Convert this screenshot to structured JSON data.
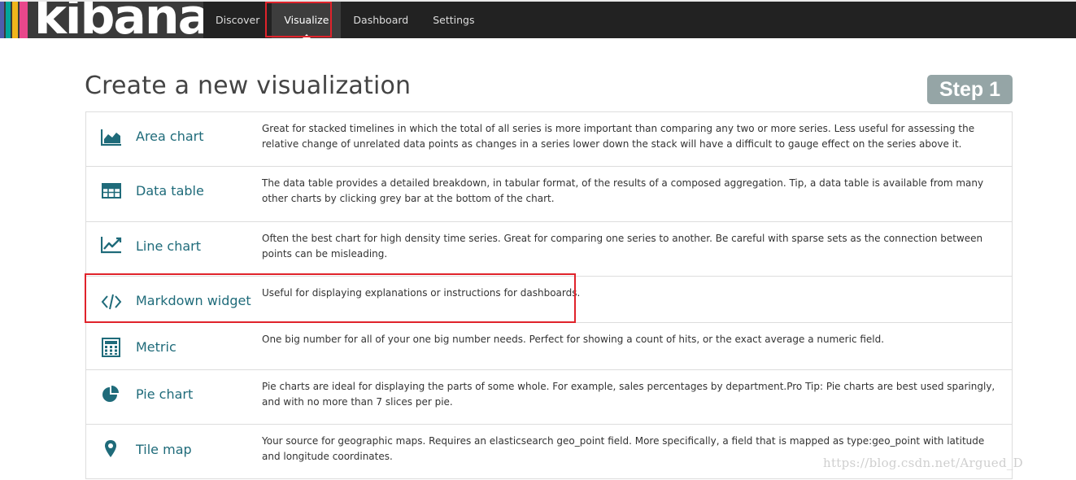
{
  "brand": {
    "logo_text": "kibana",
    "stripe_colors": [
      "#e8478b",
      "#f0b51b",
      "#00a69b",
      "#4e5dad"
    ]
  },
  "nav": {
    "items": [
      {
        "label": "Discover",
        "active": false
      },
      {
        "label": "Visualize",
        "active": true
      },
      {
        "label": "Dashboard",
        "active": false
      },
      {
        "label": "Settings",
        "active": false
      }
    ]
  },
  "page": {
    "title": "Create a new visualization",
    "step_label": "Step 1"
  },
  "visualizations": [
    {
      "name": "Area chart",
      "icon": "area-chart-icon",
      "description": "Great for stacked timelines in which the total of all series is more important than comparing any two or more series. Less useful for assessing the relative change of unrelated data points as changes in a series lower down the stack will have a difficult to gauge effect on the series above it."
    },
    {
      "name": "Data table",
      "icon": "table-icon",
      "description": "The data table provides a detailed breakdown, in tabular format, of the results of a composed aggregation. Tip, a data table is available from many other charts by clicking grey bar at the bottom of the chart."
    },
    {
      "name": "Line chart",
      "icon": "line-chart-icon",
      "description": "Often the best chart for high density time series. Great for comparing one series to another. Be careful with sparse sets as the connection between points can be misleading."
    },
    {
      "name": "Markdown widget",
      "icon": "code-icon",
      "description": "Useful for displaying explanations or instructions for dashboards."
    },
    {
      "name": "Metric",
      "icon": "calculator-icon",
      "description": "One big number for all of your one big number needs. Perfect for showing a count of hits, or the exact average a numeric field."
    },
    {
      "name": "Pie chart",
      "icon": "pie-chart-icon",
      "description": "Pie charts are ideal for displaying the parts of some whole. For example, sales percentages by department.Pro Tip: Pie charts are best used sparingly, and with no more than 7 slices per pie."
    },
    {
      "name": "Tile map",
      "icon": "map-marker-icon",
      "description": "Your source for geographic maps. Requires an elasticsearch geo_point field. More specifically, a field that is mapped as type:geo_point with latitude and longitude coordinates."
    }
  ],
  "watermark": "https://blog.csdn.net/Argued_D",
  "colors": {
    "link": "#1f6b7a",
    "badge": "#95a5a6",
    "highlight": "#e0232b",
    "nav_bg": "#222222"
  }
}
